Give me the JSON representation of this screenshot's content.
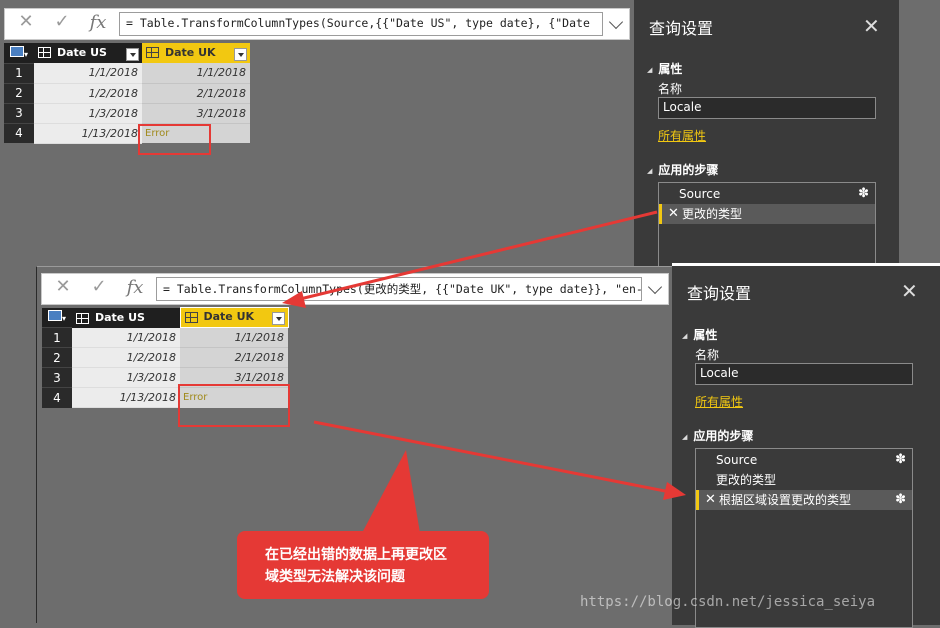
{
  "formula_bar": {
    "cancel_icon": "close-icon",
    "confirm_icon": "check-icon",
    "fx_label": "fx"
  },
  "top": {
    "formula": "= Table.TransformColumnTypes(Source,{{\"Date US\", type date}, {\"Date",
    "columns": [
      "Date US",
      "Date UK"
    ],
    "rows": [
      {
        "n": "1",
        "us": "1/1/2018",
        "uk": "1/1/2018"
      },
      {
        "n": "2",
        "us": "1/2/2018",
        "uk": "2/1/2018"
      },
      {
        "n": "3",
        "us": "1/3/2018",
        "uk": "3/1/2018"
      },
      {
        "n": "4",
        "us": "1/13/2018",
        "uk": "Error"
      }
    ]
  },
  "bottom": {
    "formula": "= Table.TransformColumnTypes(更改的类型, {{\"Date UK\", type date}}, \"en-",
    "columns": [
      "Date US",
      "Date UK"
    ],
    "rows": [
      {
        "n": "1",
        "us": "1/1/2018",
        "uk": "1/1/2018"
      },
      {
        "n": "2",
        "us": "1/2/2018",
        "uk": "2/1/2018"
      },
      {
        "n": "3",
        "us": "1/3/2018",
        "uk": "3/1/2018"
      },
      {
        "n": "4",
        "us": "1/13/2018",
        "uk": "Error"
      }
    ]
  },
  "query_settings_top": {
    "title": "查询设置",
    "properties_heading": "属性",
    "name_label": "名称",
    "name_value": "Locale",
    "all_properties_link": "所有属性",
    "applied_steps_heading": "应用的步骤",
    "steps": [
      "Source",
      "更改的类型"
    ]
  },
  "query_settings_bottom": {
    "title": "查询设置",
    "properties_heading": "属性",
    "name_label": "名称",
    "name_value": "Locale",
    "all_properties_link": "所有属性",
    "applied_steps_heading": "应用的步骤",
    "steps": [
      "Source",
      "更改的类型",
      "根据区域设置更改的类型"
    ]
  },
  "callout": {
    "line1": "在已经出错的数据上再更改区",
    "line2": "域类型无法解决该问题"
  },
  "watermark": "https://blog.csdn.net/jessica_seiya",
  "colors": {
    "accent": "#f2c811",
    "annotation": "#e53935"
  }
}
